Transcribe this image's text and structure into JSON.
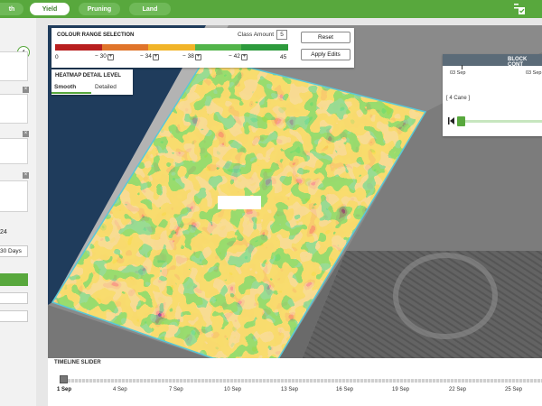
{
  "topnav": {
    "tabs": [
      {
        "label": "th",
        "active": false
      },
      {
        "label": "Yield",
        "active": true
      },
      {
        "label": "Pruning",
        "active": false
      },
      {
        "label": "Land",
        "active": false
      }
    ]
  },
  "left_panel": {
    "date_fragment": "24",
    "range_fragment": "30 Days"
  },
  "colour_range": {
    "title": "COLOUR RANGE SELECTION",
    "class_amount_label": "Class Amount",
    "class_amount_value": "5",
    "min": "0",
    "max": "45",
    "steps": [
      "30",
      "34",
      "38",
      "42"
    ],
    "reset_label": "Reset",
    "apply_label": "Apply Edits",
    "colors": [
      "#b81f1f",
      "#e0742a",
      "#f1b428",
      "#52b44a",
      "#2d9a3c"
    ]
  },
  "heatmap_detail": {
    "title": "HEATMAP DETAIL LEVEL",
    "options": [
      {
        "label": "Smooth",
        "active": true
      },
      {
        "label": "Detailed",
        "active": false
      }
    ]
  },
  "block_control": {
    "title": "BLOCK CONT",
    "date_left": "03 Sep",
    "date_right": "03 Sep",
    "cane_info": "[ 4 Cane ]"
  },
  "timeline": {
    "title": "TIMELINE SLIDER",
    "labels": [
      "1 Sep",
      "4 Sep",
      "7 Sep",
      "10 Sep",
      "13 Sep",
      "16 Sep",
      "19 Sep",
      "22 Sep",
      "25 Sep"
    ],
    "selected": "1 Sep"
  }
}
